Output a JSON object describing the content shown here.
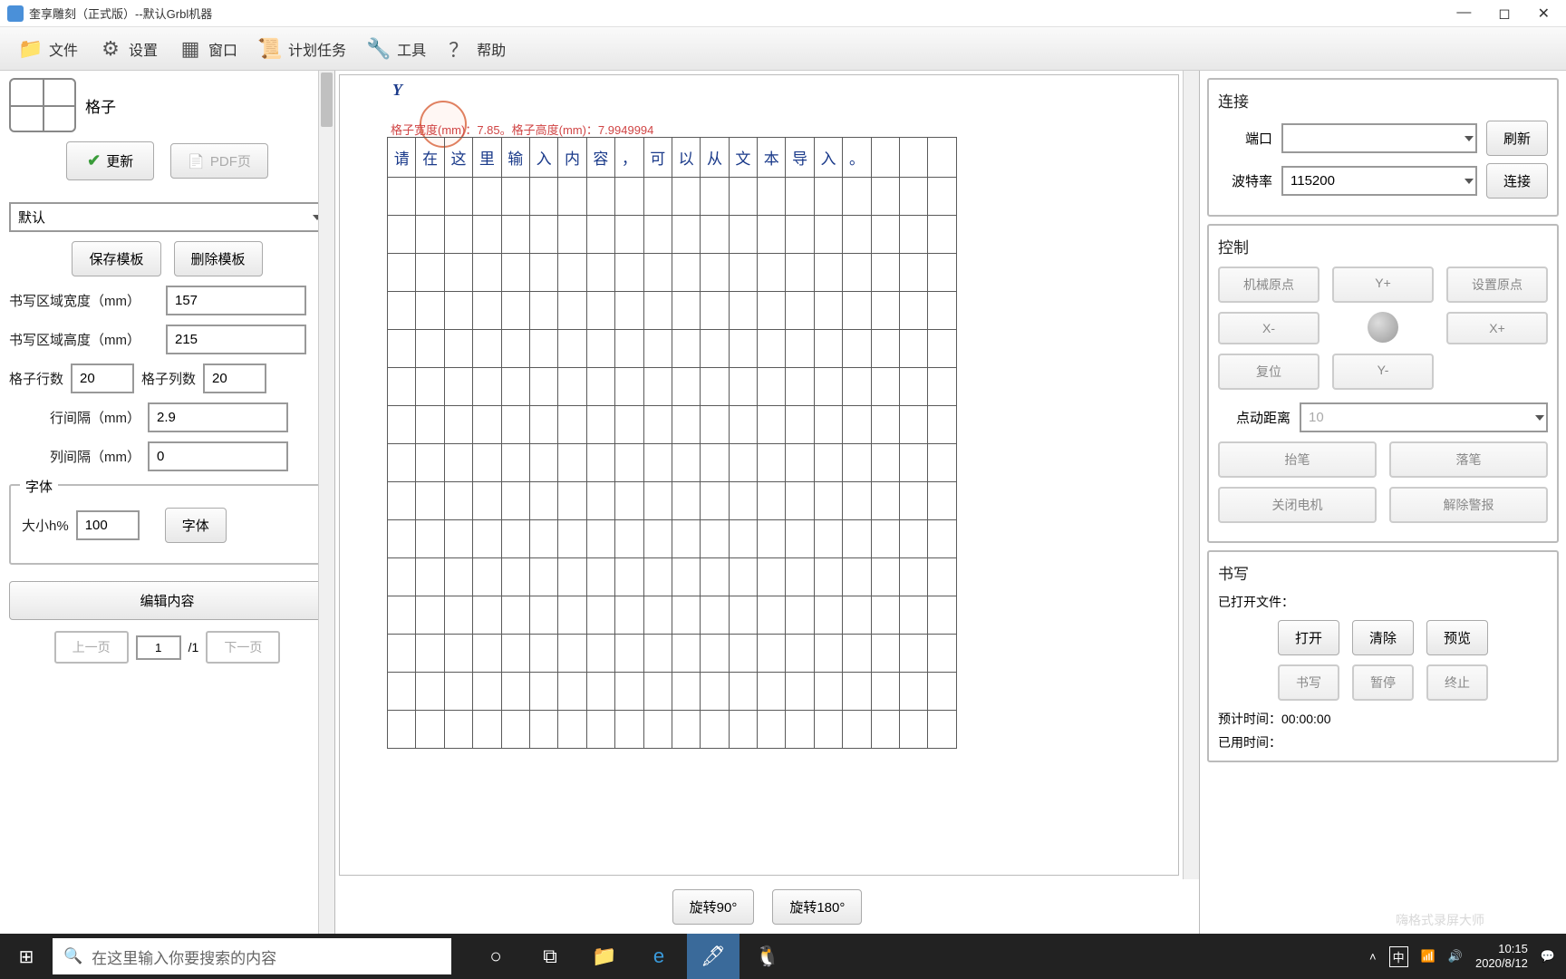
{
  "title": "奎享雕刻（正式版）--默认Grbl机器",
  "menu": {
    "file": "文件",
    "settings": "设置",
    "window": "窗口",
    "plan": "计划任务",
    "tools": "工具",
    "help": "帮助"
  },
  "left": {
    "tile_label": "格子",
    "update": "更新",
    "pdf": "PDF页",
    "template_select": "默认",
    "save_template": "保存模板",
    "delete_template": "删除模板",
    "width_label": "书写区域宽度（mm）",
    "width_val": "157",
    "height_label": "书写区域高度（mm）",
    "height_val": "215",
    "rows_label": "格子行数",
    "rows_val": "20",
    "cols_label": "格子列数",
    "cols_val": "20",
    "row_gap_label": "行间隔（mm）",
    "row_gap_val": "2.9",
    "col_gap_label": "列间隔（mm）",
    "col_gap_val": "0",
    "font_legend": "字体",
    "font_size_label": "大小h%",
    "font_size_val": "100",
    "font_btn": "字体",
    "edit_content": "编辑内容",
    "prev_page": "上一页",
    "page_val": "1",
    "page_total": "/1",
    "next_page": "下一页"
  },
  "canvas": {
    "y_label": "Y",
    "info": "格子宽度(mm)：7.85。格子高度(mm)：7.9949994",
    "sample_chars": [
      "请",
      "在",
      "这",
      "里",
      "输",
      "入",
      "内",
      "容",
      "，",
      "可",
      "以",
      "从",
      "文",
      "本",
      "导",
      "入",
      "。"
    ],
    "rotate90": "旋转90°",
    "rotate180": "旋转180°"
  },
  "right": {
    "connect_title": "连接",
    "port_label": "端口",
    "refresh": "刷新",
    "baud_label": "波特率",
    "baud_val": "115200",
    "connect_btn": "连接",
    "control_title": "控制",
    "home": "机械原点",
    "yplus": "Y+",
    "set_origin": "设置原点",
    "xminus": "X-",
    "xplus": "X+",
    "reset": "复位",
    "yminus": "Y-",
    "jog_label": "点动距离",
    "jog_val": "10",
    "pen_up": "抬笔",
    "pen_down": "落笔",
    "motor_off": "关闭电机",
    "clear_alarm": "解除警报",
    "write_title": "书写",
    "opened_label": "已打开文件：",
    "open": "打开",
    "clear": "清除",
    "preview": "预览",
    "write": "书写",
    "pause": "暂停",
    "stop": "终止",
    "eta_label": "预计时间：",
    "eta_val": "00:00:00",
    "elapsed_label": "已用时间："
  },
  "taskbar": {
    "search_placeholder": "在这里输入你要搜索的内容",
    "time": "10:15",
    "date": "2020/8/12",
    "ime": "中",
    "watermark": "嗨格式录屏大师"
  }
}
